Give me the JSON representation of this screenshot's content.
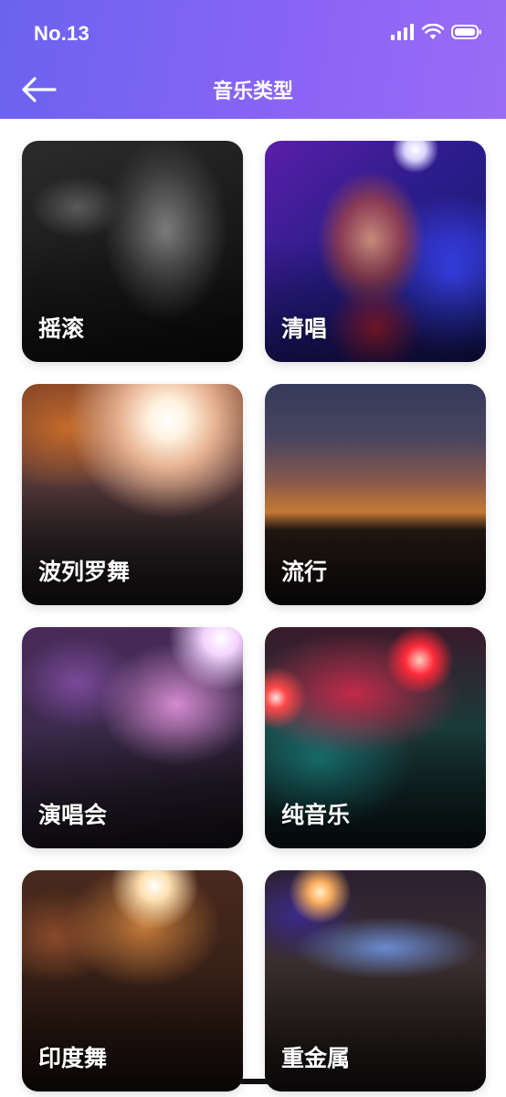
{
  "status": {
    "time": "No.13"
  },
  "header": {
    "title": "音乐类型",
    "back_icon": "arrow-left-icon"
  },
  "genres": [
    {
      "label": "摇滚"
    },
    {
      "label": "清唱"
    },
    {
      "label": "波列罗舞"
    },
    {
      "label": "流行"
    },
    {
      "label": "演唱会"
    },
    {
      "label": "纯音乐"
    },
    {
      "label": "印度舞"
    },
    {
      "label": "重金属"
    }
  ],
  "colors": {
    "header_start": "#6a63ef",
    "header_end": "#9a6cf6"
  }
}
